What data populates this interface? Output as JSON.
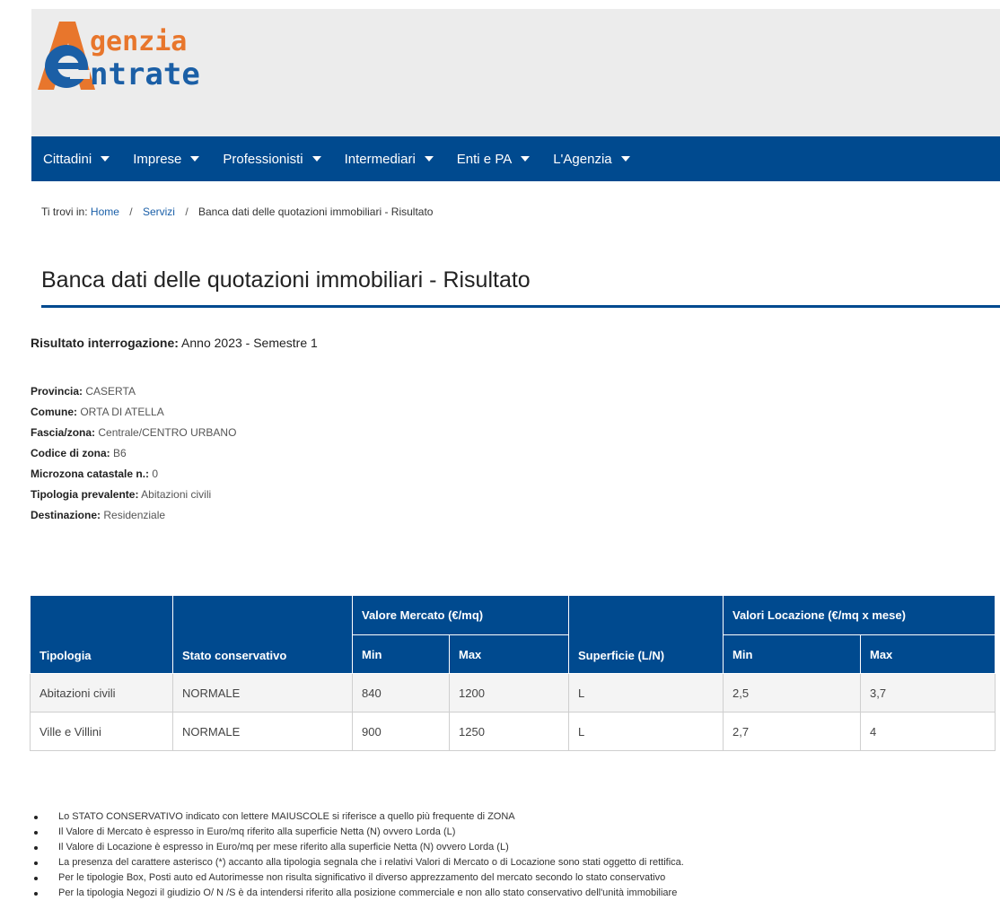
{
  "logo": {
    "line1": "genzia",
    "line2": "ntrate",
    "icon": "agenzia-entrate-logo"
  },
  "nav": [
    {
      "label": "Cittadini"
    },
    {
      "label": "Imprese"
    },
    {
      "label": "Professionisti"
    },
    {
      "label": "Intermediari"
    },
    {
      "label": "Enti e PA"
    },
    {
      "label": "L'Agenzia"
    }
  ],
  "breadcrumb": {
    "prefix": "Ti trovi in:",
    "home": "Home",
    "services": "Servizi",
    "separator": "/",
    "current": "Banca dati delle quotazioni immobiliari - Risultato"
  },
  "page": {
    "title": "Banca dati delle quotazioni immobiliari - Risultato"
  },
  "result": {
    "label": "Risultato interrogazione:",
    "value": "Anno 2023 - Semestre 1"
  },
  "info": [
    {
      "label": "Provincia:",
      "value": "CASERTA"
    },
    {
      "label": "Comune:",
      "value": "ORTA DI ATELLA"
    },
    {
      "label": "Fascia/zona:",
      "value": "Centrale/CENTRO URBANO"
    },
    {
      "label": "Codice di zona:",
      "value": "B6"
    },
    {
      "label": "Microzona catastale n.:",
      "value": "0"
    },
    {
      "label": "Tipologia prevalente:",
      "value": "Abitazioni civili"
    },
    {
      "label": "Destinazione:",
      "value": "Residenziale"
    }
  ],
  "table": {
    "headers": {
      "tipologia": "Tipologia",
      "stato": "Stato conservativo",
      "mercato": "Valore Mercato (€/mq)",
      "superficie": "Superficie (L/N)",
      "locazione": "Valori Locazione (€/mq x mese)",
      "min": "Min",
      "max": "Max"
    },
    "rows": [
      [
        "Abitazioni civili",
        "NORMALE",
        "840",
        "1200",
        "L",
        "2,5",
        "3,7"
      ],
      [
        "Ville e Villini",
        "NORMALE",
        "900",
        "1250",
        "L",
        "2,7",
        "4"
      ]
    ]
  },
  "notes": [
    "Lo STATO CONSERVATIVO indicato con lettere MAIUSCOLE si riferisce a quello più frequente di ZONA",
    "Il Valore di Mercato è espresso in Euro/mq riferito alla superficie Netta (N) ovvero Lorda (L)",
    "Il Valore di Locazione è espresso in Euro/mq per mese riferito alla superficie Netta (N) ovvero Lorda (L)",
    "La presenza del carattere asterisco (*) accanto alla tipologia segnala che i relativi Valori di Mercato o di Locazione sono stati oggetto di rettifica.",
    "Per le tipologie Box, Posti auto ed Autorimesse non risulta significativo il diverso apprezzamento del mercato secondo lo stato conservativo",
    "Per la tipologia Negozi il giudizio O/ N /S è da intendersi riferito alla posizione commerciale e non allo stato conservativo dell'unità immobiliare"
  ],
  "colors": {
    "brand_blue": "#004a8f",
    "logo_orange": "#e8762c"
  }
}
